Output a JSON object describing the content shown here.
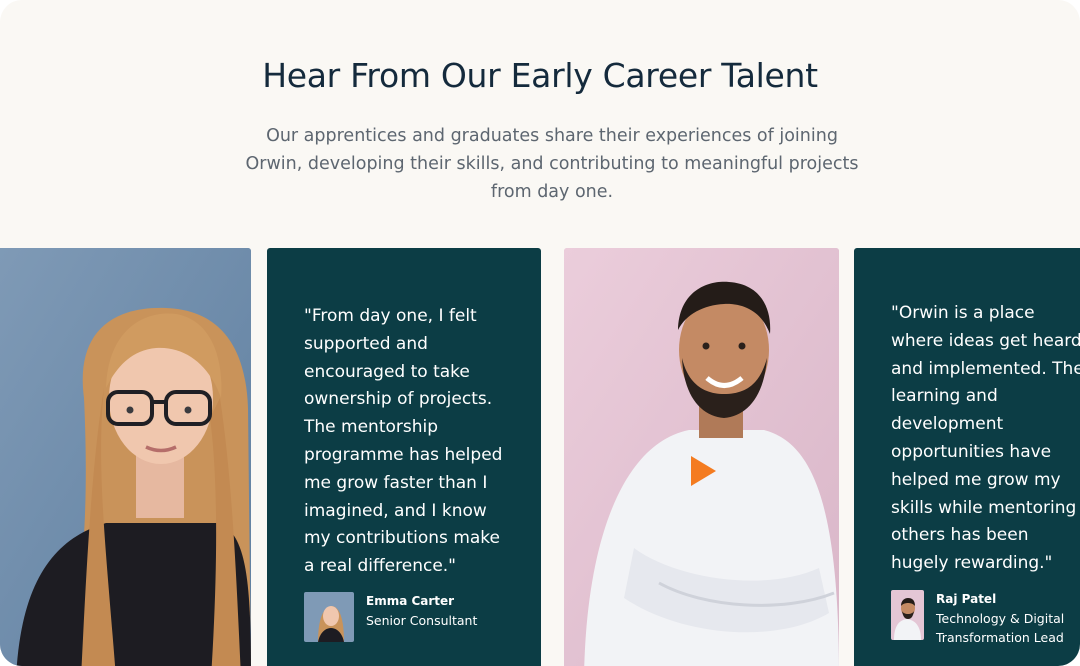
{
  "header": {
    "title": "Hear From Our Early Career Talent",
    "subtitle": "Our apprentices and graduates share their experiences of joining Orwin, developing their skills, and contributing to meaningful projects from day one."
  },
  "testimonials": [
    {
      "quote": "\"From day one, I felt supported and encouraged to take ownership of projects. The mentorship programme has helped me grow faster than I imagined, and I know my contributions make a real difference.\"",
      "name": "Emma Carter",
      "role": "Senior Consultant"
    },
    {
      "quote": "\"Orwin is a place where ideas get heard and implemented. The learning and development opportunities have helped me grow my skills while mentoring others has been hugely rewarding.\"",
      "name": "Raj Patel",
      "role": "Technology & Digital Transformation Lead"
    }
  ],
  "colors": {
    "background": "#faf8f4",
    "title": "#142a3c",
    "card_dark": "#0c3d45",
    "accent_play": "#f47b20"
  },
  "icons": {
    "video": "play-icon"
  }
}
